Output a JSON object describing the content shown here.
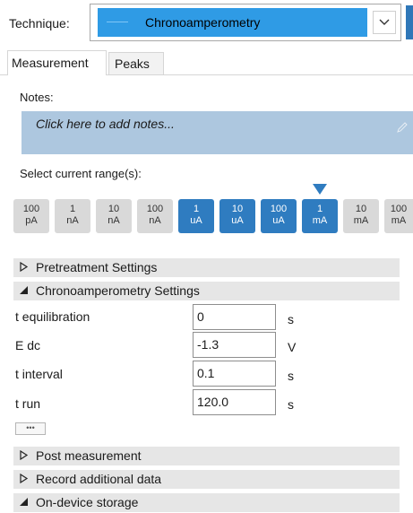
{
  "technique": {
    "label": "Technique:",
    "value": "Chronoamperometry"
  },
  "tabs": [
    {
      "label": "Measurement",
      "active": true
    },
    {
      "label": "Peaks",
      "active": false
    }
  ],
  "notes": {
    "label": "Notes:",
    "placeholder": "Click here to add notes..."
  },
  "current_range": {
    "label": "Select current range(s):",
    "buttons": [
      {
        "top": "100",
        "bottom": "pA",
        "selected": false
      },
      {
        "top": "1",
        "bottom": "nA",
        "selected": false
      },
      {
        "top": "10",
        "bottom": "nA",
        "selected": false
      },
      {
        "top": "100",
        "bottom": "nA",
        "selected": false
      },
      {
        "top": "1",
        "bottom": "uA",
        "selected": true
      },
      {
        "top": "10",
        "bottom": "uA",
        "selected": true
      },
      {
        "top": "100",
        "bottom": "uA",
        "selected": true
      },
      {
        "top": "1",
        "bottom": "mA",
        "selected": true,
        "marked": true
      },
      {
        "top": "10",
        "bottom": "mA",
        "selected": false
      },
      {
        "top": "100",
        "bottom": "mA",
        "selected": false
      }
    ]
  },
  "sections": {
    "pretreatment": {
      "label": "Pretreatment Settings",
      "expanded": false
    },
    "chrono": {
      "label": "Chronoamperometry Settings",
      "expanded": true
    },
    "post": {
      "label": "Post measurement",
      "expanded": false
    },
    "record": {
      "label": "Record additional data",
      "expanded": false
    },
    "storage": {
      "label": "On-device storage",
      "expanded": true
    }
  },
  "params": [
    {
      "label": "t equilibration",
      "value": "0",
      "unit": "s"
    },
    {
      "label": "E dc",
      "value": "-1.3",
      "unit": "V"
    },
    {
      "label": "t interval",
      "value": "0.1",
      "unit": "s"
    },
    {
      "label": "t run",
      "value": "120.0",
      "unit": "s"
    }
  ],
  "more_button": "•••",
  "colors": {
    "accent": "#2f9be5",
    "range_selected": "#2f7cc0",
    "range_unselected": "#d9d9d9",
    "notes_bg": "#adc7df",
    "section_bg": "#e6e6e6"
  }
}
